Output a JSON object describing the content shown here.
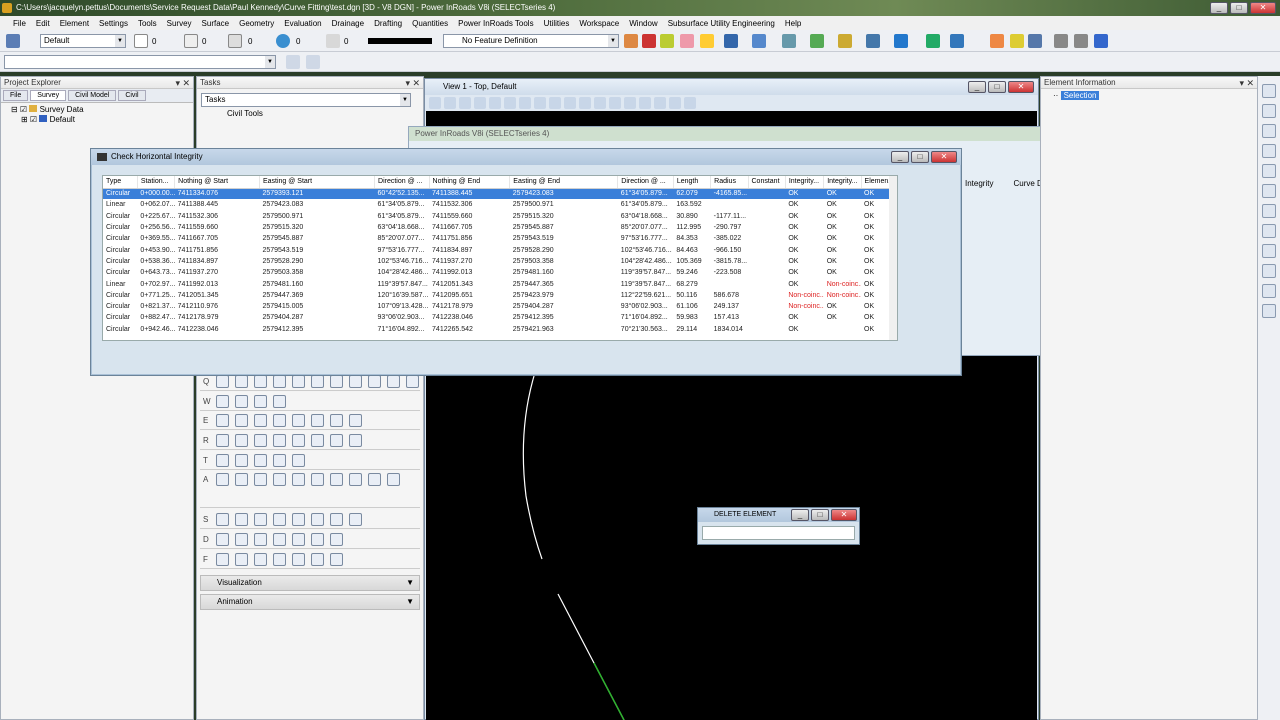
{
  "app": {
    "title": "C:\\Users\\jacquelyn.pettus\\Documents\\Service Request Data\\Paul Kennedy\\Curve Fitting\\test.dgn [3D - V8 DGN] - Power InRoads V8i (SELECTseries 4)"
  },
  "menu": [
    "File",
    "Edit",
    "Element",
    "Settings",
    "Tools",
    "Survey",
    "Surface",
    "Geometry",
    "Evaluation",
    "Drainage",
    "Drafting",
    "Quantities",
    "Power InRoads Tools",
    "Utilities",
    "Workspace",
    "Window",
    "Subsurface Utility Engineering",
    "Help"
  ],
  "toolbar": {
    "level": "Default",
    "color_val": "0",
    "style_val": "0",
    "weight_val": "0",
    "trans_val": "0",
    "priority_val": "0",
    "feature_def": "No Feature Definition"
  },
  "project_explorer": {
    "title": "Project Explorer",
    "tabs": [
      "File",
      "Survey",
      "Civil Model",
      "Civil"
    ],
    "tree": [
      "Survey Data",
      "Default"
    ]
  },
  "tasks": {
    "title": "Tasks",
    "combo": "Tasks",
    "group": "Civil Tools",
    "row_letters": [
      "Q",
      "W",
      "E",
      "R",
      "T",
      "A",
      "S",
      "D",
      "F"
    ],
    "sections": [
      "Visualization",
      "Animation"
    ]
  },
  "view": {
    "title": "View 1 - Top, Default"
  },
  "element_info": {
    "title": "Element Information",
    "selection": "Selection"
  },
  "background_window": {
    "title": "Power InRoads V8i (SELECTseries 4)",
    "columns": [
      "Integrity",
      "Curve Defin"
    ]
  },
  "dialog": {
    "title": "Check Horizontal Integrity",
    "columns": [
      "Type",
      "Station...",
      "Nothing @ Start",
      "Easting @ Start",
      "Direction @ ...",
      "Nothing @ End",
      "Easting @ End",
      "Direction @ ...",
      "Length",
      "Radius",
      "Constant",
      "Integrity...",
      "Integrity...",
      "Elemen..."
    ],
    "rows": [
      [
        "Circular",
        "0+000.00...",
        "7411334.076",
        "2579393.121",
        "60°42'52.135...",
        "7411388.445",
        "2579423.083",
        "61°34'05.879...",
        "62.079",
        "-4165.85...",
        "",
        "OK",
        "OK",
        "OK"
      ],
      [
        "Linear",
        "0+062.07...",
        "7411388.445",
        "2579423.083",
        "61°34'05.879...",
        "7411532.306",
        "2579500.971",
        "61°34'05.879...",
        "163.592",
        "",
        "",
        "OK",
        "OK",
        "OK"
      ],
      [
        "Circular",
        "0+225.67...",
        "7411532.306",
        "2579500.971",
        "61°34'05.879...",
        "7411559.660",
        "2579515.320",
        "63°04'18.668...",
        "30.890",
        "-1177.11...",
        "",
        "OK",
        "OK",
        "OK"
      ],
      [
        "Circular",
        "0+256.56...",
        "7411559.660",
        "2579515.320",
        "63°04'18.668...",
        "7411667.705",
        "2579545.887",
        "85°20'07.077...",
        "112.995",
        "-290.797",
        "",
        "OK",
        "OK",
        "OK"
      ],
      [
        "Circular",
        "0+369.55...",
        "7411667.705",
        "2579545.887",
        "85°20'07.077...",
        "7411751.856",
        "2579543.519",
        "97°53'16.777...",
        "84.353",
        "-385.022",
        "",
        "OK",
        "OK",
        "OK"
      ],
      [
        "Circular",
        "0+453.90...",
        "7411751.856",
        "2579543.519",
        "97°53'16.777...",
        "7411834.897",
        "2579528.290",
        "102°53'46.716...",
        "84.463",
        "-966.150",
        "",
        "OK",
        "OK",
        "OK"
      ],
      [
        "Circular",
        "0+538.36...",
        "7411834.897",
        "2579528.290",
        "102°53'46.716...",
        "7411937.270",
        "2579503.358",
        "104°28'42.486...",
        "105.369",
        "-3815.78...",
        "",
        "OK",
        "OK",
        "OK"
      ],
      [
        "Circular",
        "0+643.73...",
        "7411937.270",
        "2579503.358",
        "104°28'42.486...",
        "7411992.013",
        "2579481.160",
        "119°39'57.847...",
        "59.246",
        "-223.508",
        "",
        "OK",
        "OK",
        "OK"
      ],
      [
        "Linear",
        "0+702.97...",
        "7411992.013",
        "2579481.160",
        "119°39'57.847...",
        "7412051.343",
        "2579447.365",
        "119°39'57.847...",
        "68.279",
        "",
        "",
        "OK",
        "Non-coinc...",
        "OK"
      ],
      [
        "Circular",
        "0+771.25...",
        "7412051.345",
        "2579447.369",
        "120°16'39.587...",
        "7412095.651",
        "2579423.979",
        "112°22'59.621...",
        "50.116",
        "586.678",
        "",
        "Non-coinc...",
        "Non-coinc...",
        "OK"
      ],
      [
        "Circular",
        "0+821.37...",
        "7412110.976",
        "2579415.005",
        "107°09'13.428...",
        "7412178.979",
        "2579404.287",
        "93°06'02.903...",
        "61.106",
        "249.137",
        "",
        "Non-coinc...",
        "OK",
        "OK"
      ],
      [
        "Circular",
        "0+882.47...",
        "7412178.979",
        "2579404.287",
        "93°06'02.903...",
        "7412238.046",
        "2579412.395",
        "71°16'04.892...",
        "59.983",
        "157.413",
        "",
        "OK",
        "OK",
        "OK"
      ],
      [
        "Circular",
        "0+942.46...",
        "7412238.046",
        "2579412.395",
        "71°16'04.892...",
        "7412265.542",
        "2579421.963",
        "70°21'30.563...",
        "29.114",
        "1834.014",
        "",
        "OK",
        "",
        "OK"
      ]
    ]
  },
  "delete_dialog": {
    "title": "DELETE ELEMENT"
  }
}
